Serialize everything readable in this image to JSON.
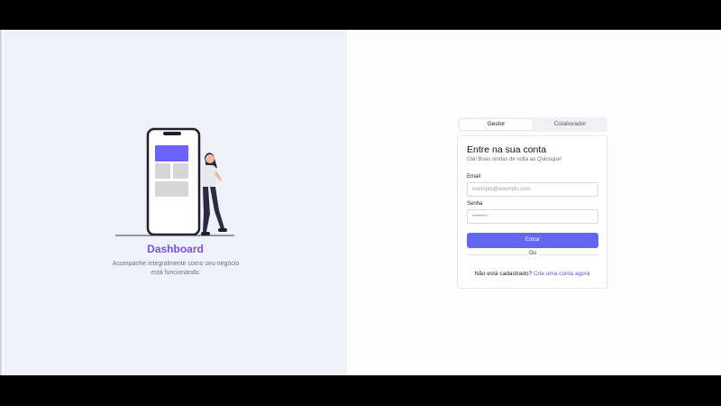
{
  "left_panel": {
    "title": "Dashboard",
    "description": "Acompanhe integralmente como seu negócio está funcionando."
  },
  "tabs": [
    {
      "label": "Gestor",
      "active": true
    },
    {
      "label": "Colaborador",
      "active": false
    }
  ],
  "login": {
    "title": "Entre na sua conta",
    "subtitle": "Olá! Boas vindas de volta ao Quiosque!",
    "email_label": "Email",
    "email_placeholder": "exemplo@exemplo.com",
    "password_label": "Senha",
    "password_placeholder": "••••••••",
    "submit_label": "Entrar",
    "divider_text": "Ou",
    "signup_prompt": "Não está cadastrado?",
    "signup_link": "Crie uma conta agora"
  },
  "colors": {
    "accent": "#6366f1",
    "title_purple": "#7b52d6",
    "phone_block": "#6c63ff"
  },
  "icons": [
    "phone-illustration",
    "woman-illustration"
  ]
}
